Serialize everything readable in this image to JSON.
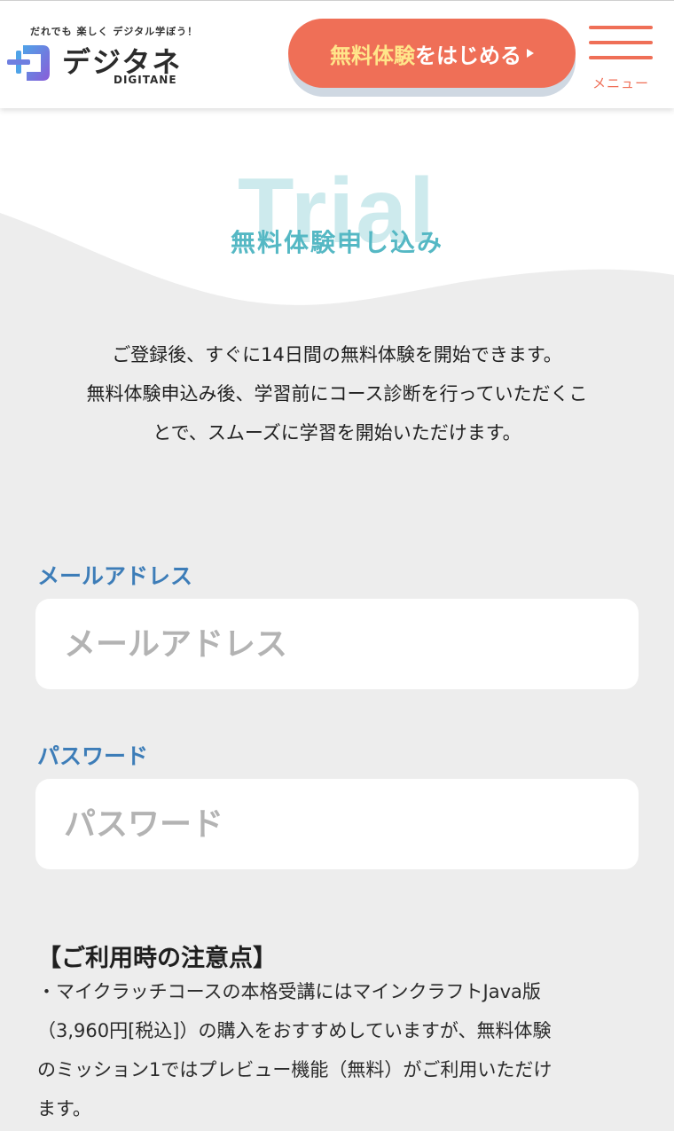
{
  "header": {
    "logo": {
      "tagline": "だれでも 楽しく デジタル学ぼう！",
      "name": "デジタネ",
      "roman": "DIGITANE"
    },
    "cta": {
      "highlight": "無料体験",
      "rest": "をはじめる"
    },
    "menu_label": "メニュー"
  },
  "hero": {
    "watermark": "Trial",
    "title": "無料体験申し込み"
  },
  "intro": {
    "lines": [
      "ご登録後、すぐに14日間の無料体験を開始できます。",
      "無料体験申込み後、学習前にコース診断を行っていただくこ",
      "とで、スムーズに学習を開始いただけます。"
    ]
  },
  "form": {
    "email": {
      "label": "メールアドレス",
      "placeholder": "メールアドレス",
      "value": ""
    },
    "password": {
      "label": "パスワード",
      "placeholder": "パスワード",
      "value": ""
    }
  },
  "notes": {
    "title": "【ご利用時の注意点】",
    "lines": [
      "・マイクラッチコースの本格受講にはマインクラフトJava版",
      "（3,960円[税込]）の購入をおすすめしていますが、無料体験",
      "のミッション1ではプレビュー機能（無料）がご利用いただけ",
      "ます。"
    ]
  },
  "colors": {
    "accent": "#ef6f57",
    "cta_highlight": "#ffe58a",
    "teal": "#55b8c4",
    "label_blue": "#3d7db8",
    "background": "#ededed"
  },
  "icons": {
    "logo_mark": "digitane-plus-logo-icon",
    "menu": "hamburger-menu-icon",
    "cta_arrow": "play-arrow-icon"
  }
}
